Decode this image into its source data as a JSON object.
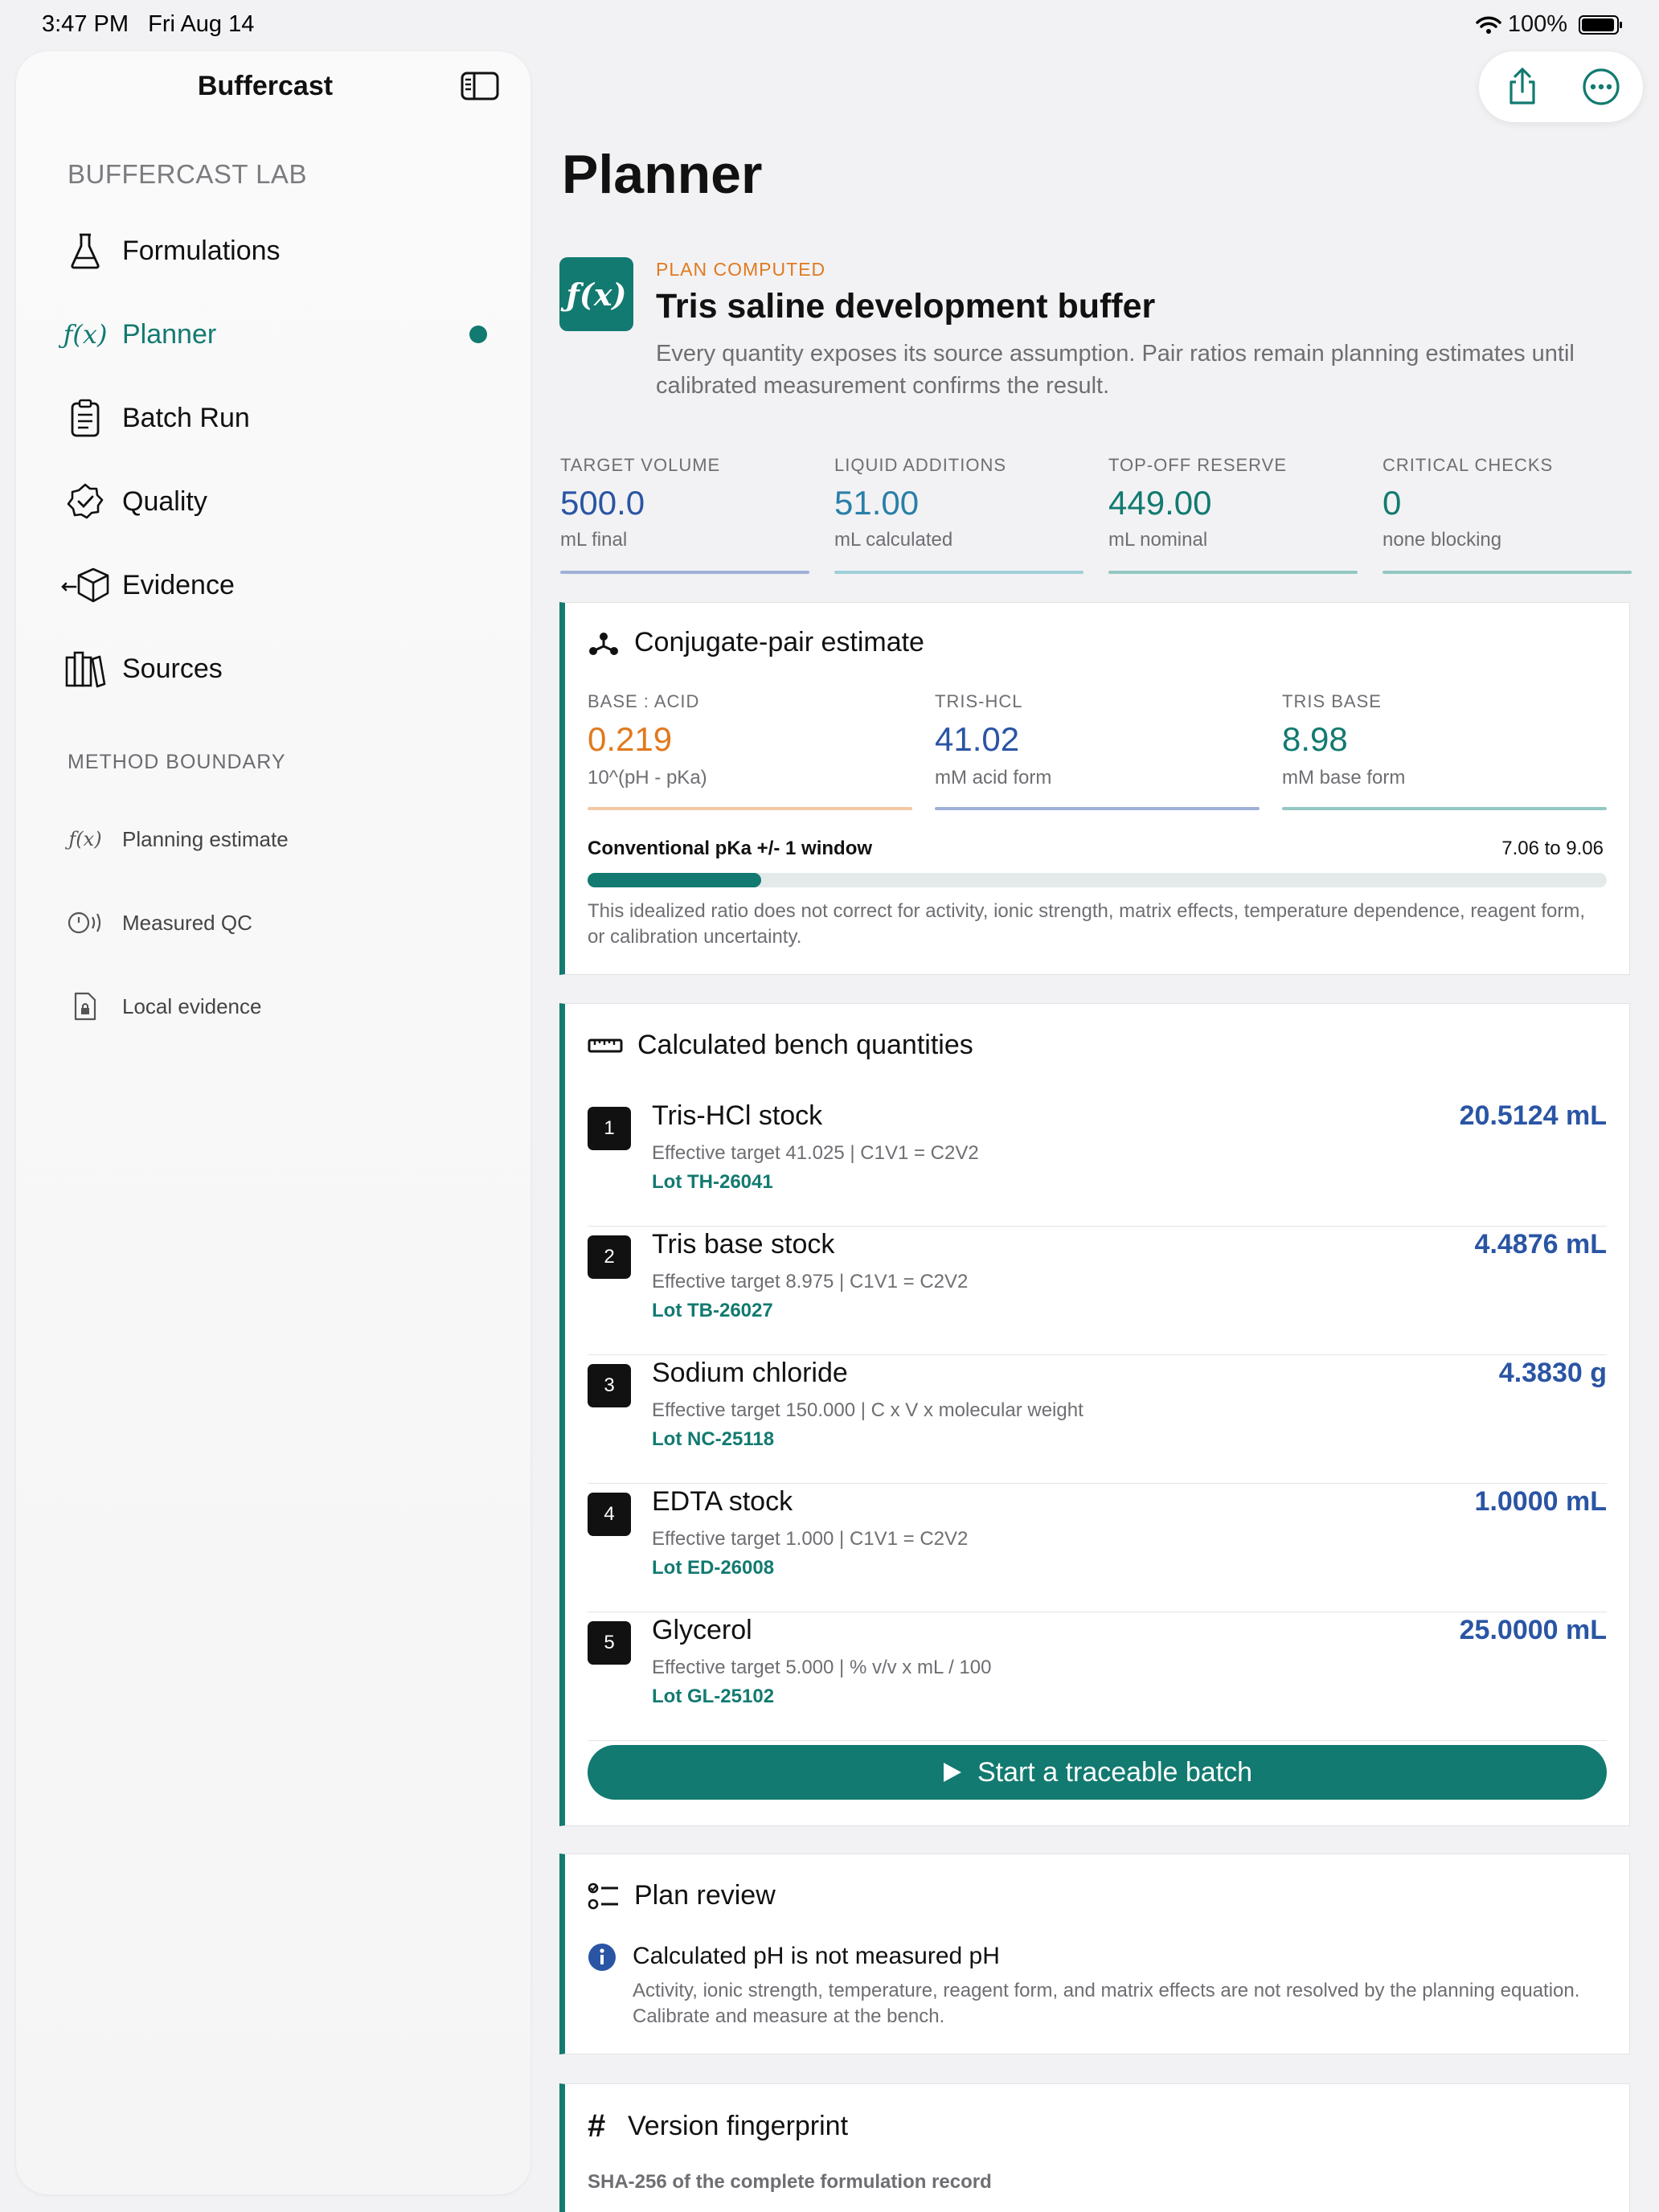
{
  "status_bar": {
    "time": "3:47 PM",
    "date": "Fri Aug 14",
    "battery": "100%"
  },
  "sidebar": {
    "title": "Buffercast",
    "section_label": "BUFFERCAST LAB",
    "items": [
      {
        "label": "Formulations",
        "icon": "flask-icon"
      },
      {
        "label": "Planner",
        "icon": "function-icon",
        "active": true
      },
      {
        "label": "Batch Run",
        "icon": "clipboard-icon"
      },
      {
        "label": "Quality",
        "icon": "seal-check-icon"
      },
      {
        "label": "Evidence",
        "icon": "box-icon"
      },
      {
        "label": "Sources",
        "icon": "books-icon"
      }
    ],
    "boundary_label": "METHOD BOUNDARY",
    "boundary_items": [
      {
        "label": "Planning estimate",
        "icon": "function-icon"
      },
      {
        "label": "Measured QC",
        "icon": "sensor-icon"
      },
      {
        "label": "Local evidence",
        "icon": "doc-lock-icon"
      }
    ]
  },
  "toolbar": {
    "share_icon": "share-icon",
    "more_icon": "ellipsis-icon"
  },
  "page": {
    "title": "Planner"
  },
  "hero": {
    "icon_text": "ƒ(x)",
    "status": "PLAN COMPUTED",
    "title": "Tris saline development buffer",
    "description": "Every quantity exposes its source assumption. Pair ratios remain planning estimates until calibrated measurement confirms the result."
  },
  "metrics": [
    {
      "label": "TARGET VOLUME",
      "value": "500.0",
      "unit": "mL final",
      "color": "#2a55a4"
    },
    {
      "label": "LIQUID ADDITIONS",
      "value": "51.00",
      "unit": "mL calculated",
      "color": "#2a7fa8"
    },
    {
      "label": "TOP-OFF RESERVE",
      "value": "449.00",
      "unit": "mL nominal",
      "color": "#127a70"
    },
    {
      "label": "CRITICAL CHECKS",
      "value": "0",
      "unit": "none blocking",
      "color": "#127a70"
    }
  ],
  "conjugate": {
    "title": "Conjugate-pair estimate",
    "pairs": [
      {
        "label": "BASE : ACID",
        "value": "0.219",
        "unit": "10^(pH - pKa)",
        "color": "#e07a1f"
      },
      {
        "label": "TRIS-HCL",
        "value": "41.02",
        "unit": "mM acid form",
        "color": "#2a55a4"
      },
      {
        "label": "TRIS BASE",
        "value": "8.98",
        "unit": "mM base form",
        "color": "#127a70"
      }
    ],
    "window_label": "Conventional pKa +/- 1 window",
    "window_range": "7.06 to 9.06",
    "window_fill": 0.17,
    "note": "This idealized ratio does not correct for activity, ionic strength, matrix effects, temperature dependence, reagent form, or calibration uncertainty."
  },
  "bench": {
    "title": "Calculated bench quantities",
    "steps": [
      {
        "num": "1",
        "name": "Tris-HCl stock",
        "detail": "Effective target 41.025 | C1V1 = C2V2",
        "lot": "Lot TH-26041",
        "amount": "20.5124 mL"
      },
      {
        "num": "2",
        "name": "Tris base stock",
        "detail": "Effective target 8.975 | C1V1 = C2V2",
        "lot": "Lot TB-26027",
        "amount": "4.4876 mL"
      },
      {
        "num": "3",
        "name": "Sodium chloride",
        "detail": "Effective target 150.000 | C x V x molecular weight",
        "lot": "Lot NC-25118",
        "amount": "4.3830 g"
      },
      {
        "num": "4",
        "name": "EDTA stock",
        "detail": "Effective target 1.000 | C1V1 = C2V2",
        "lot": "Lot ED-26008",
        "amount": "1.0000 mL"
      },
      {
        "num": "5",
        "name": "Glycerol",
        "detail": "Effective target 5.000 | % v/v x mL / 100",
        "lot": "Lot GL-25102",
        "amount": "25.0000 mL"
      }
    ],
    "cta_label": "Start a traceable batch"
  },
  "review": {
    "title": "Plan review",
    "item_title": "Calculated pH is not measured pH",
    "item_text": "Activity, ionic strength, temperature, reagent form, and matrix effects are not resolved by the planning equation. Calibrate and measure at the bench."
  },
  "fingerprint": {
    "title": "Version fingerprint",
    "subtitle": "SHA-256 of the complete formulation record"
  }
}
